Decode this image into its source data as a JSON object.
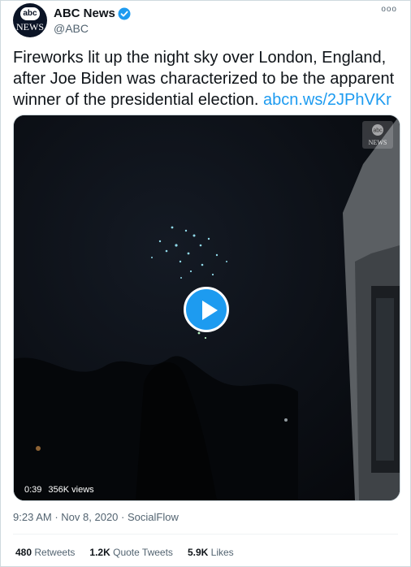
{
  "author": {
    "name": "ABC News",
    "handle": "@ABC",
    "avatar_top": "abc",
    "avatar_bottom": "NEWS",
    "verified_color": "#1d9bf0"
  },
  "more_label": "ooo",
  "tweet": {
    "text": "Fireworks lit up the night sky over London, England, after Joe Biden was characterized to be the apparent winner of the presidential election.",
    "link": "abcn.ws/2JPhVKr"
  },
  "video": {
    "duration": "0:39",
    "views": "356K views",
    "watermark_top": "abc",
    "watermark_bottom": "NEWS",
    "play_icon": "play-icon"
  },
  "meta": {
    "time": "9:23 AM",
    "date": "Nov 8, 2020",
    "source": "SocialFlow",
    "separator": "·"
  },
  "stats": {
    "retweets_count": "480",
    "retweets_label": "Retweets",
    "quotes_count": "1.2K",
    "quotes_label": "Quote Tweets",
    "likes_count": "5.9K",
    "likes_label": "Likes"
  },
  "colors": {
    "link": "#1d9bf0",
    "text": "#0f1419",
    "muted": "#536471"
  }
}
